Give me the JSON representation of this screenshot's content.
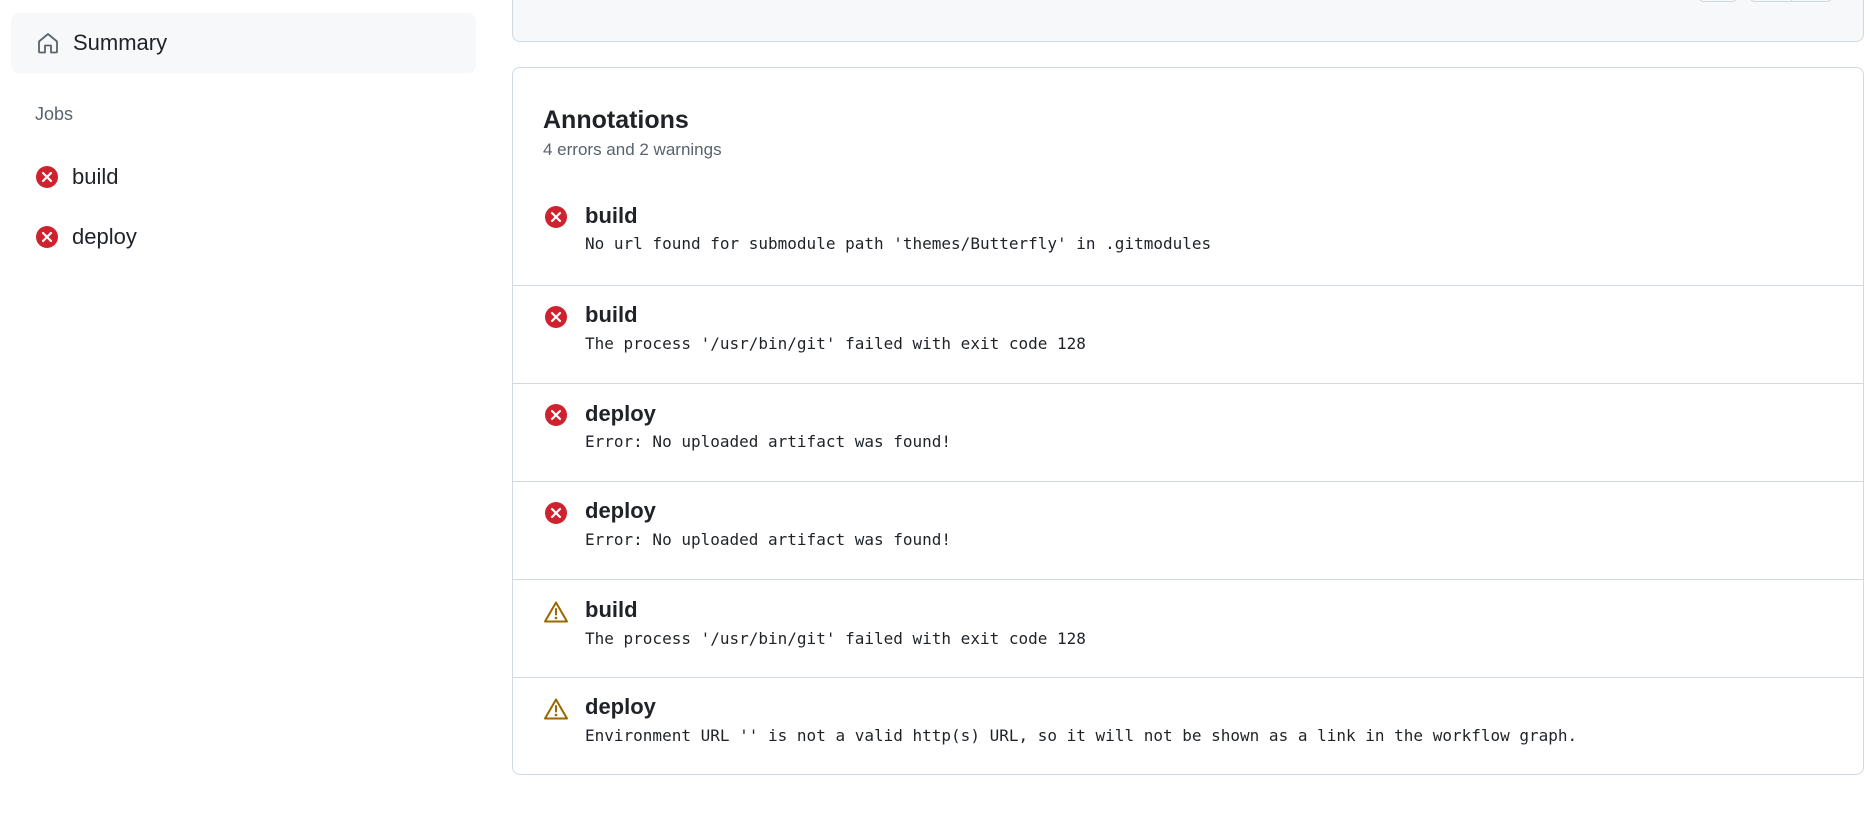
{
  "sidebar": {
    "summary_label": "Summary",
    "jobs_heading": "Jobs",
    "jobs": [
      {
        "label": "build",
        "status": "failure"
      },
      {
        "label": "deploy",
        "status": "failure"
      }
    ]
  },
  "annotations": {
    "title": "Annotations",
    "subtitle": "4 errors and 2 warnings",
    "items": [
      {
        "type": "error",
        "job": "build",
        "message": "No url found for submodule path 'themes/Butterfly' in .gitmodules"
      },
      {
        "type": "error",
        "job": "build",
        "message": "The process '/usr/bin/git' failed with exit code 128"
      },
      {
        "type": "error",
        "job": "deploy",
        "message": "Error: No uploaded artifact was found!"
      },
      {
        "type": "error",
        "job": "deploy",
        "message": "Error: No uploaded artifact was found!"
      },
      {
        "type": "warning",
        "job": "build",
        "message": "The process '/usr/bin/git' failed with exit code 128"
      },
      {
        "type": "warning",
        "job": "deploy",
        "message": "Environment URL '' is not a valid http(s) URL, so it will not be shown as a link in the workflow graph."
      }
    ]
  },
  "colors": {
    "error": "#cf222e",
    "warning": "#9a6700",
    "muted": "#59636e",
    "border": "#d1d9e0",
    "subtle_bg": "#f6f8fa"
  },
  "icons": {
    "summary": "home-icon",
    "error": "x-circle-fill-icon",
    "warning": "alert-triangle-icon"
  }
}
